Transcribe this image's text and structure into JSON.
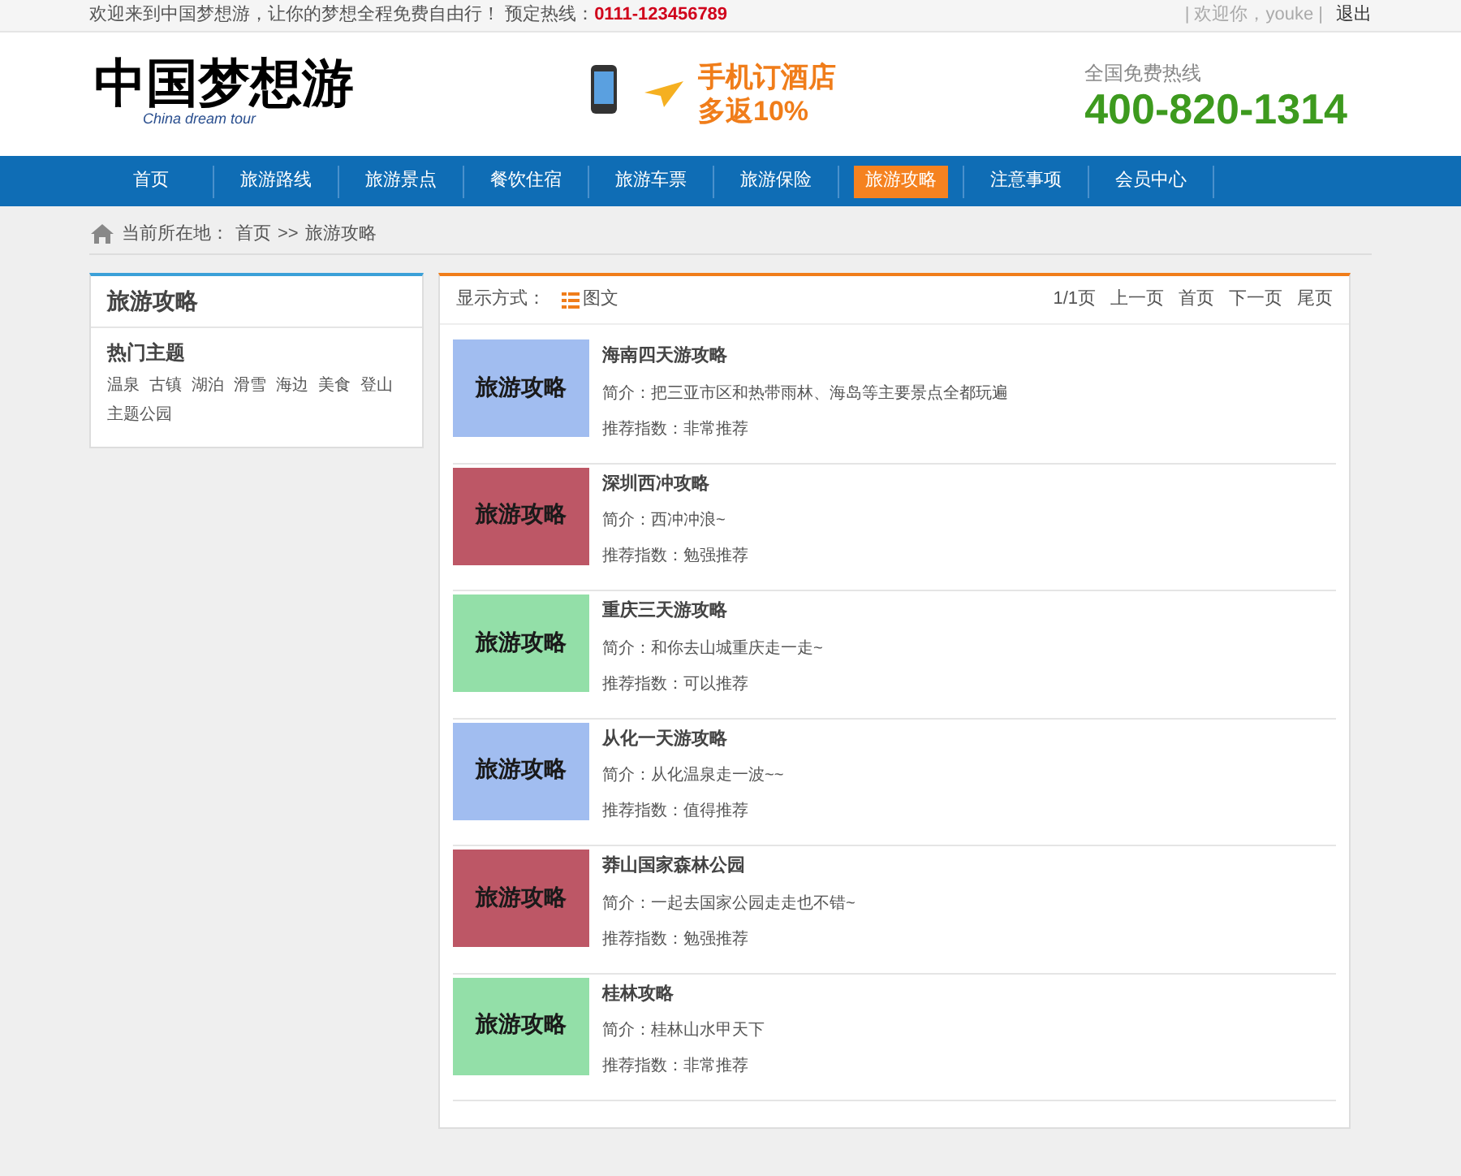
{
  "top_bar": {
    "welcome": "欢迎来到中国梦想游，让你的梦想全程免费自由行！ 预定热线：",
    "hotline": "0111-123456789",
    "user": "| 欢迎你，youke |",
    "logout": "退出"
  },
  "header": {
    "logo": "中国梦想游",
    "logo_sub": "China dream tour",
    "promo_line1": "手机订酒店",
    "promo_line2": "多返10%",
    "phone_label": "全国免费热线",
    "phone": "400-820-1314"
  },
  "nav": [
    {
      "label": "首页",
      "selected": false
    },
    {
      "label": "旅游路线",
      "selected": false
    },
    {
      "label": "旅游景点",
      "selected": false
    },
    {
      "label": "餐饮住宿",
      "selected": false
    },
    {
      "label": "旅游车票",
      "selected": false
    },
    {
      "label": "旅游保险",
      "selected": false
    },
    {
      "label": "旅游攻略",
      "selected": true
    },
    {
      "label": "注意事项",
      "selected": false
    },
    {
      "label": "会员中心",
      "selected": false
    }
  ],
  "breadcrumb": {
    "label": "当前所在地：",
    "home": "首页",
    "sep": ">>",
    "current": "旅游攻略"
  },
  "sidebar": {
    "title": "旅游攻略",
    "section": "热门主题",
    "tags": [
      "温泉",
      "古镇",
      "湖泊",
      "滑雪",
      "海边",
      "美食",
      "登山",
      "主题公园"
    ]
  },
  "list_toolbar": {
    "display_label": "显示方式：",
    "display_mode": "图文",
    "pager": [
      "1/1页",
      "上一页",
      "首页",
      "下一页",
      "尾页"
    ]
  },
  "articles": [
    {
      "thumb_text": "旅游攻略",
      "color": "#a1bdf0",
      "title": "海南四天游攻略",
      "intro": "简介：把三亚市区和热带雨林、海岛等主要景点全都玩遍",
      "rating": "推荐指数：非常推荐"
    },
    {
      "thumb_text": "旅游攻略",
      "color": "#bd5766",
      "title": "深圳西冲攻略",
      "intro": "简介：西冲冲浪~",
      "rating": "推荐指数：勉强推荐"
    },
    {
      "thumb_text": "旅游攻略",
      "color": "#93dfa8",
      "title": "重庆三天游攻略",
      "intro": "简介：和你去山城重庆走一走~",
      "rating": "推荐指数：可以推荐"
    },
    {
      "thumb_text": "旅游攻略",
      "color": "#a1bdf0",
      "title": "从化一天游攻略",
      "intro": "简介：从化温泉走一波~~",
      "rating": "推荐指数：值得推荐"
    },
    {
      "thumb_text": "旅游攻略",
      "color": "#bd5766",
      "title": "莽山国家森林公园",
      "intro": "简介：一起去国家公园走走也不错~",
      "rating": "推荐指数：勉强推荐"
    },
    {
      "thumb_text": "旅游攻略",
      "color": "#93dfa8",
      "title": "桂林攻略",
      "intro": "简介：桂林山水甲天下",
      "rating": "推荐指数：非常推荐"
    }
  ]
}
